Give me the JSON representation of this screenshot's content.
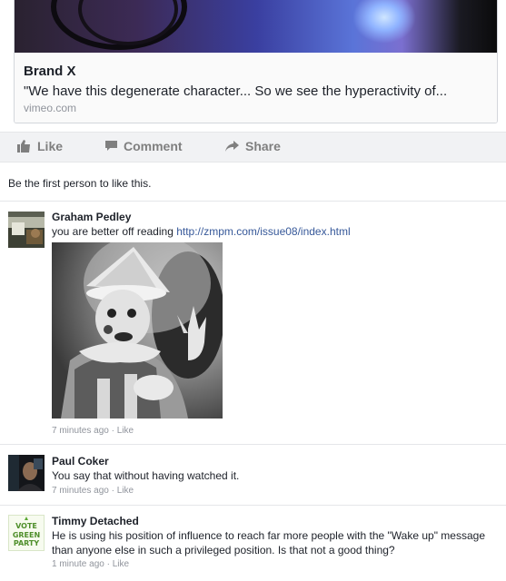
{
  "link_preview": {
    "title": "Brand X",
    "description": "\"We have this degenerate character... So we see the hyperactivity of...",
    "source": "vimeo.com"
  },
  "actions": {
    "like": "Like",
    "comment": "Comment",
    "share": "Share"
  },
  "likes_summary": "Be the first person to like this.",
  "comments": [
    {
      "author": "Graham Pedley",
      "text_prefix": "you are better off reading ",
      "link": "http://zmpm.com/issue08/index.html",
      "time": "7 minutes ago",
      "separator": " · ",
      "like": "Like"
    },
    {
      "author": "Paul Coker",
      "text": "You say that without having watched it.",
      "time": "7 minutes ago",
      "separator": " · ",
      "like": "Like"
    },
    {
      "author": "Timmy Detached",
      "text": "He is using his position of influence to reach far more people with the \"Wake up\" message than anyone else in such a privileged position. Is that not a good thing?",
      "time": "1 minute ago",
      "separator": " · ",
      "like": "Like",
      "avatar_text": [
        "VOTE",
        "GREEN",
        "PARTY"
      ]
    }
  ],
  "colors": {
    "link": "#365899",
    "meta": "#90949c",
    "action": "#7f7f7f",
    "green_party": "#5aa832"
  }
}
